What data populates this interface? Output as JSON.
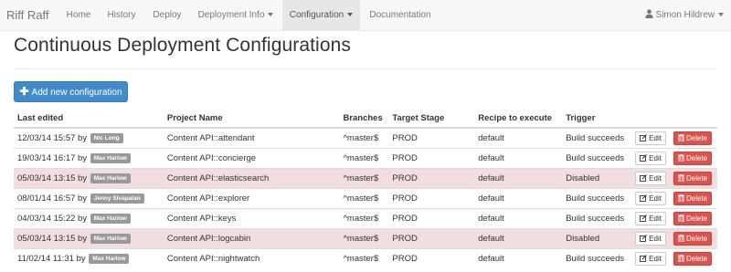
{
  "navbar": {
    "brand": "Riff Raff",
    "items": [
      {
        "label": "Home"
      },
      {
        "label": "History"
      },
      {
        "label": "Deploy"
      },
      {
        "label": "Deployment Info"
      },
      {
        "label": "Configuration"
      },
      {
        "label": "Documentation"
      }
    ],
    "user": "Simon Hildrew"
  },
  "page": {
    "title": "Continuous Deployment Configurations",
    "add_button": "Add new configuration"
  },
  "table": {
    "headers": [
      "Last edited",
      "Project Name",
      "Branches",
      "Target Stage",
      "Recipe to execute",
      "Trigger"
    ],
    "edit_label": "Edit",
    "delete_label": "Delete",
    "rows": [
      {
        "date": "12/03/14 15:57",
        "by": "by",
        "user": "Nic Long",
        "project": "Content API::attendant",
        "branch": "^master$",
        "stage": "PROD",
        "recipe": "default",
        "trigger": "Build succeeds"
      },
      {
        "date": "19/03/14 16:17",
        "by": "by",
        "user": "Max Harlow",
        "project": "Content API::concierge",
        "branch": "^master$",
        "stage": "PROD",
        "recipe": "default",
        "trigger": "Build succeeds"
      },
      {
        "date": "05/03/14 13:15",
        "by": "by",
        "user": "Max Harlow",
        "project": "Content API::elasticsearch",
        "branch": "^master$",
        "stage": "PROD",
        "recipe": "default",
        "trigger": "Disabled"
      },
      {
        "date": "08/01/14 16:57",
        "by": "by",
        "user": "Jenny Sivapalan",
        "project": "Content API::explorer",
        "branch": "^master$",
        "stage": "PROD",
        "recipe": "default",
        "trigger": "Build succeeds"
      },
      {
        "date": "04/03/14 15:22",
        "by": "by",
        "user": "Max Harlow",
        "project": "Content API::keys",
        "branch": "^master$",
        "stage": "PROD",
        "recipe": "default",
        "trigger": "Build succeeds"
      },
      {
        "date": "05/03/14 13:15",
        "by": "by",
        "user": "Max Harlow",
        "project": "Content API::logcabin",
        "branch": "^master$",
        "stage": "PROD",
        "recipe": "default",
        "trigger": "Disabled"
      },
      {
        "date": "11/02/14 11:31",
        "by": "by",
        "user": "Max Harlow",
        "project": "Content API::nightwatch",
        "branch": "^master$",
        "stage": "PROD",
        "recipe": "default",
        "trigger": "Build succeeds"
      }
    ]
  },
  "colors": {
    "navbar_bg": "#f8f8f8",
    "primary": "#428bca",
    "danger": "#d9534f",
    "disabled_row_bg": "#f2dede",
    "label_bg": "#999999"
  },
  "icons": {
    "user": "user-icon",
    "plus": "plus-icon",
    "edit": "edit-icon",
    "delete": "trash-icon"
  }
}
